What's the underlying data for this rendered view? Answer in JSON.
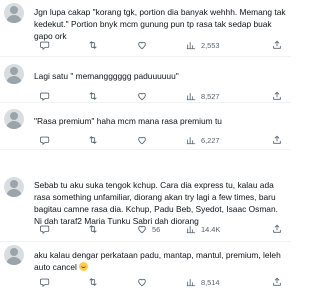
{
  "replies": [
    {
      "text": "Jgn lupa cakap \"korang tgk, portion dia banyak wehhh. Memang tak kedekut.\" Portion bnyk mcm gunung pun tp rasa tak sedap buak gapo ork",
      "views": "2,553",
      "like_count": "",
      "has_emoji": false
    },
    {
      "text": "Lagi satu \" memangggggg paduuuuuu\"",
      "views": "8,527",
      "like_count": "",
      "has_emoji": false
    },
    {
      "text": "\"Rasa premium\" haha mcm mana rasa premium tu",
      "views": "6,227",
      "like_count": "",
      "has_emoji": false
    },
    {
      "text": "Sebab tu aku suka tengok kchup. Cara dia express tu, kalau ada rasa something unfamiliar, diorang akan try lagi a few times, baru bagitau camne rasa dia. Kchup, Padu Beb, Syedot, Isaac Osman. Ni dah taraf2 Maria Tunku Sabri dah diorang",
      "views": "14.4K",
      "like_count": "56",
      "has_emoji": false
    },
    {
      "text": "aku kalau dengar perkataan padu, mantap, mantul, premium, leleh auto cancel",
      "views": "8,514",
      "like_count": "",
      "has_emoji": true
    }
  ],
  "icons": {
    "reply": "reply-icon",
    "retweet": "retweet-icon",
    "like": "like-icon",
    "views": "views-icon",
    "share": "share-icon"
  },
  "colors": {
    "text": "#0f1419",
    "muted": "#536471",
    "divider": "#eff3f4"
  }
}
